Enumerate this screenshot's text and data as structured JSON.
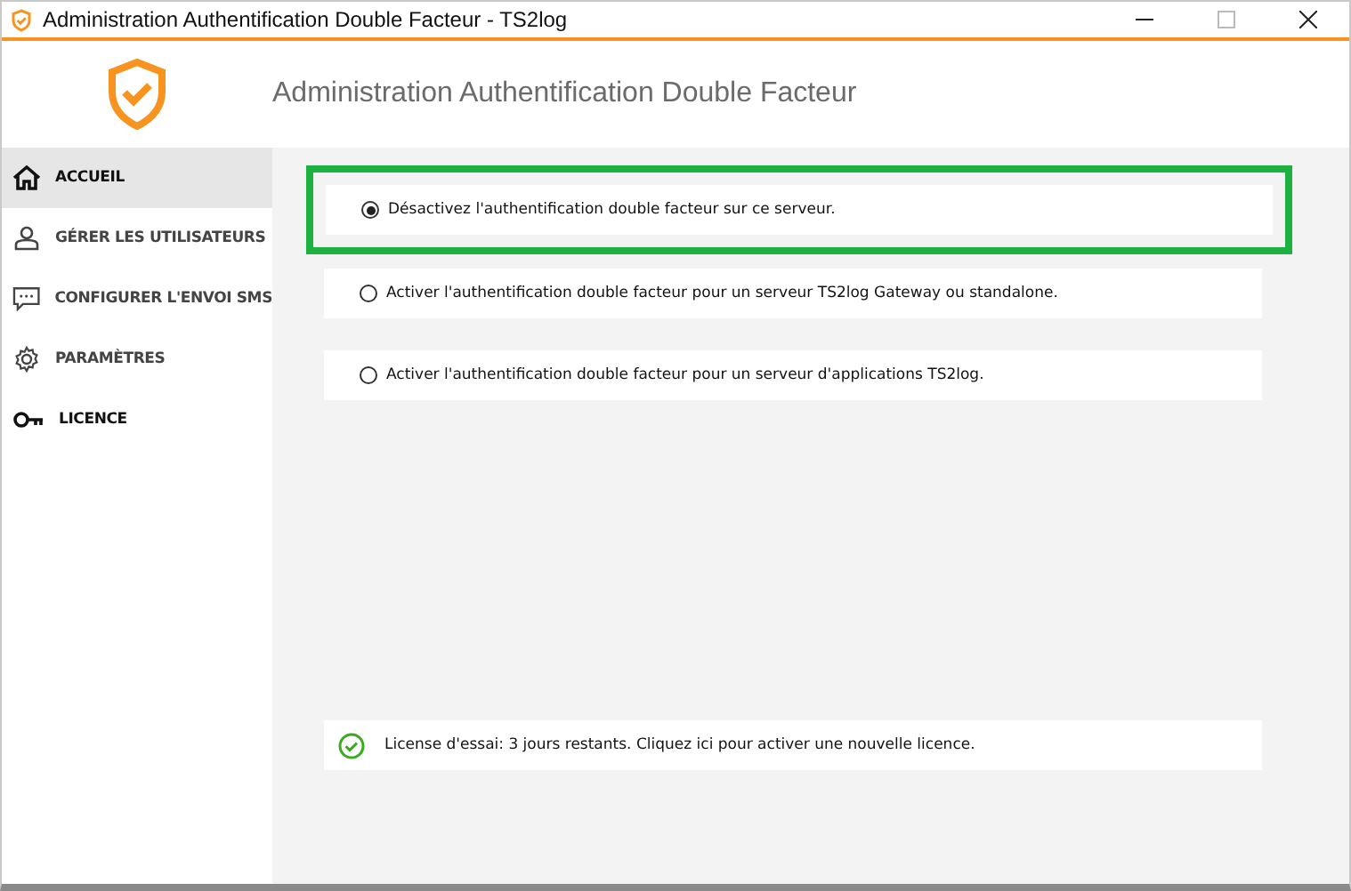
{
  "window": {
    "title": "Administration Authentification Double Facteur - TS2log"
  },
  "header": {
    "title": "Administration Authentification Double Facteur"
  },
  "sidebar": {
    "items": [
      {
        "label": "ACCUEIL",
        "kind": "home",
        "selected": true
      },
      {
        "label": "GÉRER LES UTILISATEURS",
        "kind": "user",
        "selected": false
      },
      {
        "label": "CONFIGURER L'ENVOI SMS",
        "kind": "sms",
        "selected": false
      },
      {
        "label": "PARAMÈTRES",
        "kind": "gear",
        "selected": false
      },
      {
        "label": "LICENCE",
        "kind": "key",
        "selected": false
      }
    ]
  },
  "options": [
    {
      "label": "Désactivez l'authentification double facteur sur ce serveur.",
      "selected": true
    },
    {
      "label": "Activer l'authentification double facteur pour un serveur TS2log Gateway ou standalone.",
      "selected": false
    },
    {
      "label": "Activer l'authentification double facteur pour un serveur d'applications TS2log.",
      "selected": false
    }
  ],
  "license": {
    "text": "License d'essai: 3 jours restants. Cliquez ici pour activer une nouvelle licence."
  }
}
